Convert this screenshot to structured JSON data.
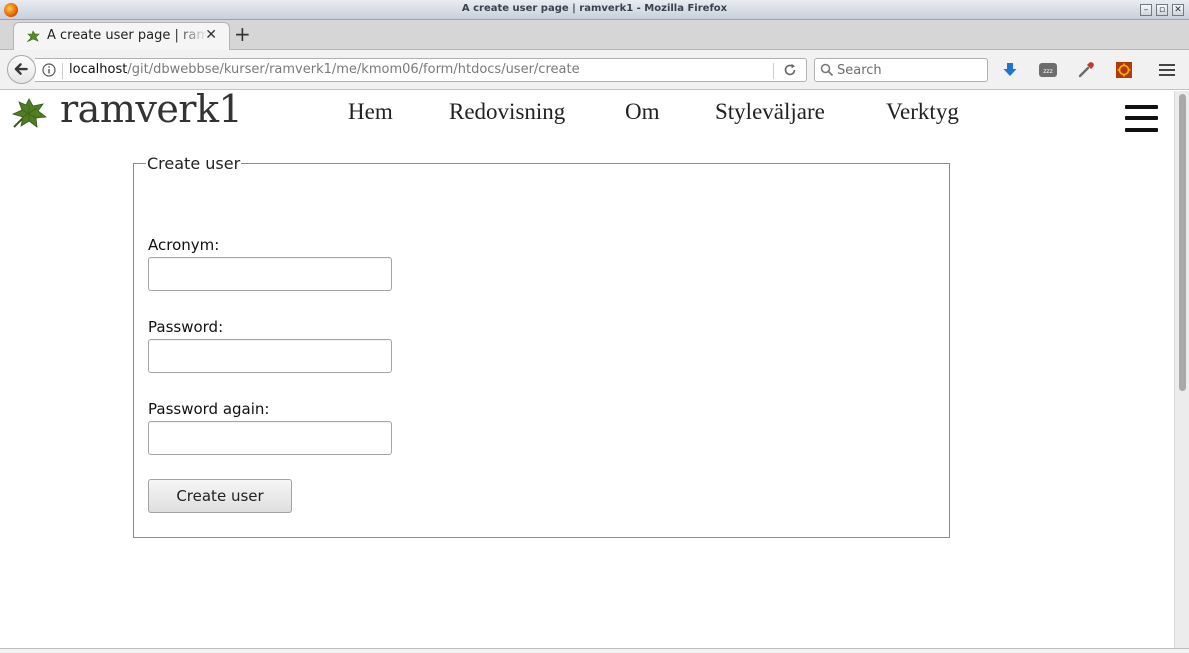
{
  "window": {
    "title": "A create user page | ramverk1 - Mozilla Firefox"
  },
  "tab": {
    "title": "A create user page | ramverk1"
  },
  "urlbar": {
    "host": "localhost",
    "path": "/git/dbwebbse/kurser/ramverk1/me/kmom06/form/htdocs/user/create"
  },
  "search": {
    "placeholder": "Search"
  },
  "site": {
    "title": "ramverk1",
    "nav": [
      "Hem",
      "Redovisning",
      "Om",
      "Styleväljare",
      "Verktyg"
    ]
  },
  "form": {
    "legend": "Create user",
    "fields": {
      "acronym": {
        "label": "Acronym:",
        "value": ""
      },
      "password": {
        "label": "Password:",
        "value": ""
      },
      "password_again": {
        "label": "Password again:",
        "value": ""
      }
    },
    "submit_label": "Create user"
  },
  "icons": {
    "app": "firefox-icon",
    "favicon": "leaf-icon",
    "back": "back-arrow-icon",
    "info": "info-icon",
    "reload": "reload-icon",
    "search": "search-icon",
    "download": "download-arrow-icon",
    "sleep": "zzz-icon",
    "eyedropper": "eyedropper-icon",
    "addon": "addon-icon",
    "menu": "hamburger-icon"
  }
}
